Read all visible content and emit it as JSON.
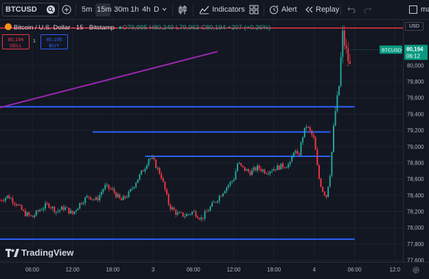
{
  "toolbar": {
    "symbol": "BTCUSD",
    "timeframes": [
      "5m",
      "15m",
      "30m",
      "1h",
      "4h",
      "D"
    ],
    "active_timeframe": "15m",
    "indicators_label": "Indicators",
    "alert_label": "Alert",
    "replay_label": "Replay",
    "user_label": "ma"
  },
  "legend": {
    "title": "Bitcoin / U.S. Dollar · 15 · Bitstamp",
    "o_key": "O",
    "o_val": "79,995",
    "h_key": "H",
    "h_val": "80,249",
    "l_key": "L",
    "l_val": "79,963",
    "c_key": "C",
    "c_val": "80,194",
    "change": "+207 (+0.26%)"
  },
  "trade": {
    "sell_price": "80,194",
    "sell_label": "SELL",
    "buy_price": "80.195",
    "buy_label": "BUY",
    "spread": "1"
  },
  "price_axis": {
    "currency": "USD",
    "ticks": [
      "80,000",
      "79,800",
      "79,600",
      "79,400",
      "79,200",
      "79,000",
      "78,800",
      "78,600",
      "78,400",
      "78,200",
      "78,000",
      "77,800",
      "77,600"
    ],
    "symbol_tag": "BTCUSD",
    "current_price": "80,194",
    "countdown": "06:12"
  },
  "time_axis": {
    "ticks": [
      "06:00",
      "12:00",
      "18:00",
      "3",
      "06:00",
      "12:00",
      "18:00",
      "4",
      "06:00",
      "12:0"
    ]
  },
  "branding": "TradingView",
  "colors": {
    "up": "#26a69a",
    "down": "#f23645",
    "hline": "#2962ff",
    "trendline": "#9c27b0",
    "resistance": "#f23645",
    "background": "#131722"
  },
  "chart_data": {
    "type": "candlestick",
    "title": "Bitcoin / U.S. Dollar · 15 · Bitstamp",
    "symbol": "BTCUSD",
    "interval": "15",
    "ylim": [
      77580,
      80560
    ],
    "yticks": [
      77600,
      77800,
      78000,
      78200,
      78400,
      78600,
      78800,
      79000,
      79200,
      79400,
      79600,
      79800,
      80000
    ],
    "xlim": [
      0,
      100
    ],
    "xticks": [
      "06:00",
      "12:00",
      "18:00",
      "3",
      "06:00",
      "12:00",
      "18:00",
      "4",
      "06:00",
      "12:0"
    ],
    "xtick_pos": [
      8,
      18,
      28,
      38,
      48,
      58,
      68,
      78,
      88,
      98
    ],
    "path_points": [
      [
        0,
        78340
      ],
      [
        2,
        78390
      ],
      [
        4,
        78300
      ],
      [
        6,
        78180
      ],
      [
        8,
        78130
      ],
      [
        10,
        78230
      ],
      [
        12,
        78290
      ],
      [
        14,
        78200
      ],
      [
        16,
        78250
      ],
      [
        18,
        78170
      ],
      [
        20,
        78310
      ],
      [
        22,
        78390
      ],
      [
        24,
        78340
      ],
      [
        26,
        78510
      ],
      [
        28,
        78460
      ],
      [
        30,
        78330
      ],
      [
        32,
        78420
      ],
      [
        34,
        78590
      ],
      [
        36,
        78750
      ],
      [
        37,
        78870
      ],
      [
        38,
        78830
      ],
      [
        40,
        78640
      ],
      [
        42,
        78270
      ],
      [
        44,
        78170
      ],
      [
        46,
        78150
      ],
      [
        48,
        78200
      ],
      [
        50,
        78110
      ],
      [
        52,
        78240
      ],
      [
        54,
        78360
      ],
      [
        56,
        78490
      ],
      [
        58,
        78600
      ],
      [
        59,
        78800
      ],
      [
        60,
        78740
      ],
      [
        62,
        78680
      ],
      [
        64,
        78740
      ],
      [
        66,
        78690
      ],
      [
        68,
        78730
      ],
      [
        70,
        78760
      ],
      [
        72,
        78780
      ],
      [
        73,
        78970
      ],
      [
        74,
        78850
      ],
      [
        75,
        79110
      ],
      [
        76,
        79260
      ],
      [
        77,
        79180
      ],
      [
        78,
        79080
      ],
      [
        79,
        78640
      ],
      [
        80,
        78470
      ],
      [
        81,
        78390
      ],
      [
        82,
        78700
      ],
      [
        83,
        79370
      ],
      [
        84,
        79640
      ],
      [
        84.5,
        80000
      ],
      [
        85,
        80390
      ],
      [
        86,
        80150
      ],
      [
        87,
        79950
      ]
    ],
    "horizontal_lines": [
      {
        "price": 80460,
        "x_from": 0,
        "x_to": 100,
        "color": "#f23645"
      },
      {
        "price": 79490,
        "x_from": 0,
        "x_to": 88,
        "color": "#2962ff"
      },
      {
        "price": 79180,
        "x_from": 23,
        "x_to": 82,
        "color": "#2962ff"
      },
      {
        "price": 78880,
        "x_from": 36,
        "x_to": 82,
        "color": "#2962ff"
      },
      {
        "price": 77860,
        "x_from": 0,
        "x_to": 88,
        "color": "#2962ff"
      }
    ],
    "trendline": {
      "x1": 0,
      "y1": 79480,
      "x2": 54,
      "y2": 80170,
      "color": "#9c27b0"
    },
    "last_price": 80194
  }
}
